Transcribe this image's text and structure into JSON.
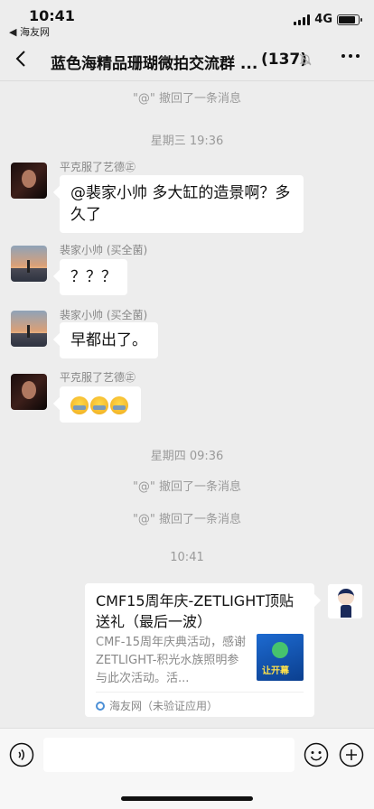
{
  "status_bar": {
    "time": "10:41",
    "back_to_app": "◀ 海友网",
    "network": "4G",
    "battery_level": 0.85
  },
  "nav": {
    "title": "蓝色海精品珊瑚微拍交流群 ...",
    "member_count": "(137)"
  },
  "messages": {
    "recall_1": "\"@\" 撤回了一条消息",
    "time_1": "星期三 19:36",
    "msg1_sender": "平克服了艺德㊣",
    "msg1_text": "@裴家小帅 多大缸的造景啊？多久了",
    "msg2_sender": "裴家小帅 (买全菌)",
    "msg2_text": "？？？",
    "msg3_sender": "裴家小帅 (买全菌)",
    "msg3_text": "早都出了。",
    "msg4_sender": "平克服了艺德㊣",
    "time_2": "星期四 09:36",
    "recall_2": "\"@\" 撤回了一条消息",
    "recall_3": "\"@\" 撤回了一条消息",
    "time_3": "10:41"
  },
  "card": {
    "title": "CMF15周年庆-ZETLIGHT顶贴送礼（最后一波）",
    "description": "CMF-15周年庆典活动，感谢 ZETLIGHT-积光水族照明参与此次活动。活...",
    "thumb_badge": "让开幕",
    "source": "海友网（未验证应用）"
  },
  "icons": {
    "back": "chevron-left-icon",
    "mute": "bell-off-icon",
    "more": "more-icon",
    "voice": "voice-icon",
    "emoji": "emoji-icon",
    "plus": "plus-icon"
  }
}
